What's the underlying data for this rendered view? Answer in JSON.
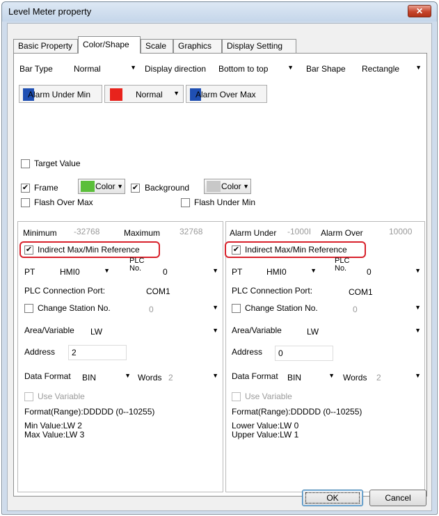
{
  "window": {
    "title": "Level Meter property",
    "close_symbol": "✕"
  },
  "tabs": [
    "Basic Property",
    "Color/Shape",
    "Scale",
    "Graphics",
    "Display Setting"
  ],
  "bar": {
    "type_label": "Bar Type",
    "type_value": "Normal",
    "direction_label": "Display direction",
    "direction_value": "Bottom to top",
    "shape_label": "Bar Shape",
    "shape_value": "Rectangle"
  },
  "alarm_colors": {
    "under": {
      "label": "Alarm Under Min",
      "color": "#1f4fb3"
    },
    "normal": {
      "label": "Normal",
      "color": "#e8231c"
    },
    "over": {
      "label": "Alarm Over Max",
      "color": "#1f4fb3"
    }
  },
  "options": {
    "target_value": "Target Value",
    "frame": "Frame",
    "frame_color": "#5bbf3a",
    "frame_color_btn": "Color",
    "background": "Background",
    "background_color": "#c8c8c8",
    "background_color_btn": "Color",
    "flash_over_max": "Flash Over Max",
    "flash_under_min": "Flash Under Min"
  },
  "left": {
    "min_label": "Minimum",
    "min_value": "-32768",
    "max_label": "Maximum",
    "max_value": "32768",
    "indirect": "Indirect Max/Min Reference",
    "pt_label": "PT",
    "pt_value": "HMI0",
    "plc_no_line1": "PLC",
    "plc_no_line2": "No.",
    "plc_no_value": "0",
    "conn_label": "PLC Connection Port:",
    "conn_value": "COM1",
    "change_station": "Change Station No.",
    "station_value": "0",
    "area_label": "Area/Variable",
    "area_value": "LW",
    "address_label": "Address",
    "address_value": "2",
    "format_label": "Data Format",
    "format_value": "BIN",
    "words_label": "Words",
    "words_value": "2",
    "use_variable": "Use Variable",
    "format_range": "Format(Range):DDDDD (0--10255)",
    "info1": "Min Value:LW 2",
    "info2": "Max Value:LW 3"
  },
  "right": {
    "under_label": "Alarm Under",
    "under_value": "-1000I",
    "over_label": "Alarm Over",
    "over_value": "10000",
    "indirect": "Indirect Max/Min Reference",
    "pt_label": "PT",
    "pt_value": "HMI0",
    "plc_no_line1": "PLC",
    "plc_no_line2": "No.",
    "plc_no_value": "0",
    "conn_label": "PLC Connection Port:",
    "conn_value": "COM1",
    "change_station": "Change Station No.",
    "station_value": "0",
    "area_label": "Area/Variable",
    "area_value": "LW",
    "address_label": "Address",
    "address_value": "0",
    "format_label": "Data Format",
    "format_value": "BIN",
    "words_label": "Words",
    "words_value": "2",
    "use_variable": "Use Variable",
    "format_range": "Format(Range):DDDDD (0--10255)",
    "info1": "Lower Value:LW 0",
    "info2": "Upper Value:LW 1"
  },
  "buttons": {
    "ok": "OK",
    "cancel": "Cancel"
  },
  "check_mark": "✔",
  "dropdown_arrow": "▼"
}
